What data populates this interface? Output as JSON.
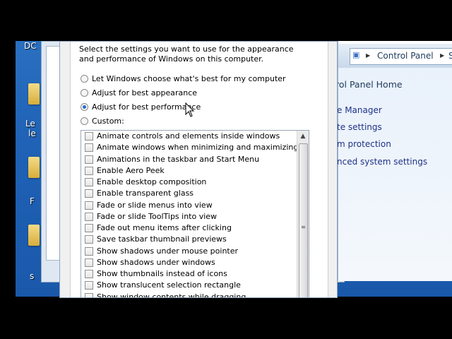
{
  "dialog": {
    "description": "Select the settings you want to use for the appearance and performance of Windows on this computer.",
    "radios": [
      {
        "label": "Let Windows choose what's best for my computer",
        "checked": false
      },
      {
        "label": "Adjust for best appearance",
        "checked": false
      },
      {
        "label": "Adjust for best performance",
        "checked": true
      },
      {
        "label": "Custom:",
        "checked": false
      }
    ],
    "effects": [
      "Animate controls and elements inside windows",
      "Animate windows when minimizing and maximizing",
      "Animations in the taskbar and Start Menu",
      "Enable Aero Peek",
      "Enable desktop composition",
      "Enable transparent glass",
      "Fade or slide menus into view",
      "Fade or slide ToolTips into view",
      "Fade out menu items after clicking",
      "Save taskbar thumbnail previews",
      "Show shadows under mouse pointer",
      "Show shadows under windows",
      "Show thumbnails instead of icons",
      "Show translucent selection rectangle",
      "Show window contents while dragging"
    ]
  },
  "control_panel": {
    "address": [
      "Control Panel",
      "Sy"
    ],
    "links": [
      "rol Panel Home",
      "e Manager",
      "te settings",
      "m protection",
      "nced system settings"
    ]
  },
  "desktop": {
    "labels": [
      "DC",
      "Le",
      "le",
      "F",
      "s"
    ]
  },
  "colors": {
    "accent": "#2a68d4",
    "link": "#1e3287",
    "desktop": "#1f62b6"
  }
}
